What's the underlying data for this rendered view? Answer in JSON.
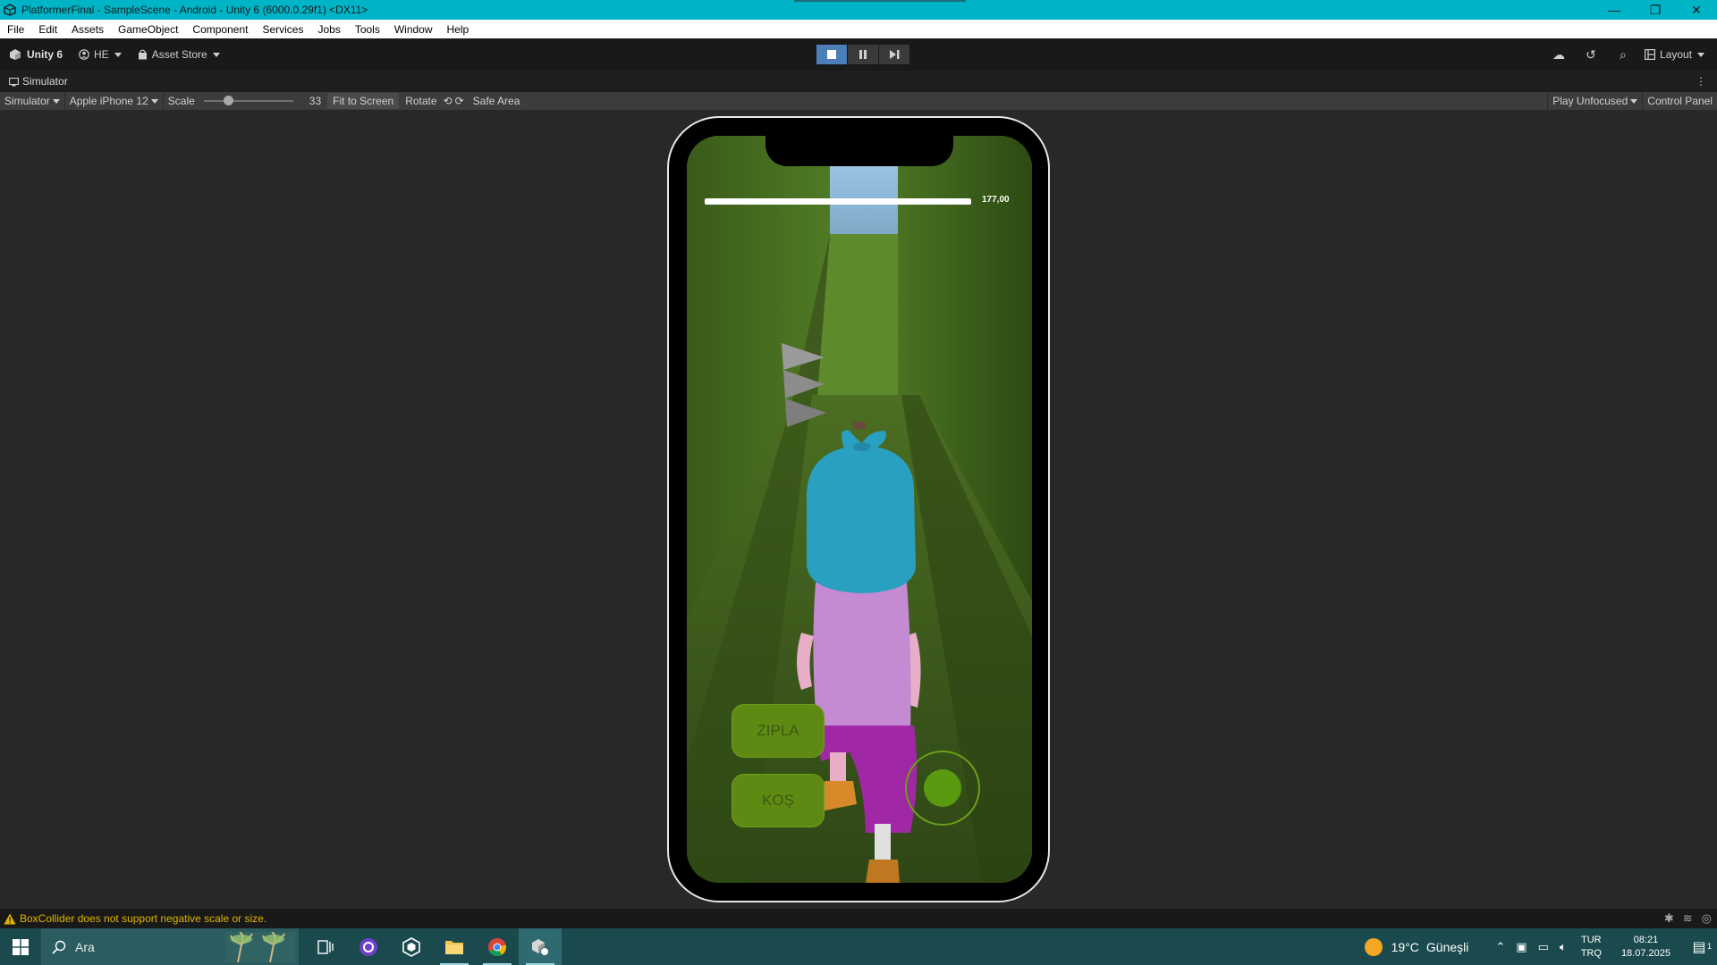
{
  "window": {
    "title": "PlatformerFinal - SampleScene - Android - Unity 6 (6000.0.29f1) <DX11>",
    "controls": [
      "—",
      "❐",
      "✕"
    ]
  },
  "menu": [
    "File",
    "Edit",
    "Assets",
    "GameObject",
    "Component",
    "Services",
    "Jobs",
    "Tools",
    "Window",
    "Help"
  ],
  "toolbar": {
    "unity_label": "Unity 6",
    "account": "HE",
    "asset_store": "Asset Store",
    "layout": "Layout"
  },
  "tab": {
    "label": "Simulator"
  },
  "simbar": {
    "mode": "Simulator",
    "device": "Apple iPhone 12",
    "scale_label": "Scale",
    "scale_value": "33",
    "fit": "Fit to Screen",
    "rotate": "Rotate",
    "safe_area": "Safe Area",
    "play_mode": "Play Unfocused",
    "control_panel": "Control Panel"
  },
  "game": {
    "health_value": "177,00",
    "jump_button": "ZIPLA",
    "run_button": "KOŞ"
  },
  "status": {
    "message": "BoxCollider does not support negative scale or size."
  },
  "taskbar": {
    "search_placeholder": "Ara",
    "temperature": "19°C",
    "weather": "Güneşli",
    "lang_top": "TUR",
    "lang_bottom": "TRQ",
    "time": "08:21",
    "date": "18.07.2025",
    "notif_count": "1"
  }
}
